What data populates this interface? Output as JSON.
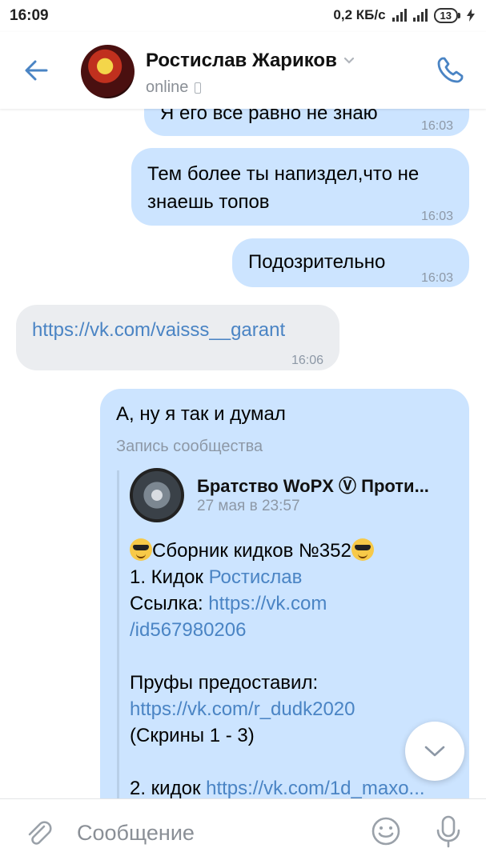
{
  "status_bar": {
    "time": "16:09",
    "net_speed": "0,2 КБ/с",
    "battery": "13"
  },
  "header": {
    "contact_name": "Ростислав Жариков",
    "status": "online",
    "back_icon": "arrow-left-icon",
    "call_icon": "phone-icon"
  },
  "messages": [
    {
      "type": "out",
      "text": "Я его все равно не знаю",
      "time": "16:03"
    },
    {
      "type": "out",
      "line1": "Тем более ты напиздел,что не",
      "line2": "знаешь топов",
      "time": "16:03"
    },
    {
      "type": "out",
      "text": "Подозрительно",
      "time": "16:03"
    },
    {
      "type": "in",
      "text": "https://vk.com/vaisss__garant",
      "time": "16:06"
    },
    {
      "type": "out",
      "text": "А, ну я так и думал",
      "attachment_label": "Запись сообщества",
      "post": {
        "author": "Братство WoPX Ⓥ Проти...",
        "date": "27 мая в 23:57",
        "title": "Сборник кидков №352",
        "l1_prefix": "1. Кидок ",
        "l1_link": "Ростислав",
        "l2_prefix": "Ссылка: ",
        "l2_link": "https://vk.com",
        "l3_link": "/id567980206",
        "l4": "Пруфы предоставил:",
        "l5_link": "https://vk.com/r_dudk2020",
        "l6": "(Скрины 1 - 3)",
        "l7_prefix": "2. кидок ",
        "l7_link": "https://vk.com/1d_maxo..."
      }
    }
  ],
  "composer": {
    "placeholder": "Сообщение"
  },
  "colors": {
    "accent": "#4a84c4",
    "outgoing_bubble": "#cce4ff",
    "incoming_bubble": "#ebedf0",
    "time_text": "#8d98a6"
  }
}
